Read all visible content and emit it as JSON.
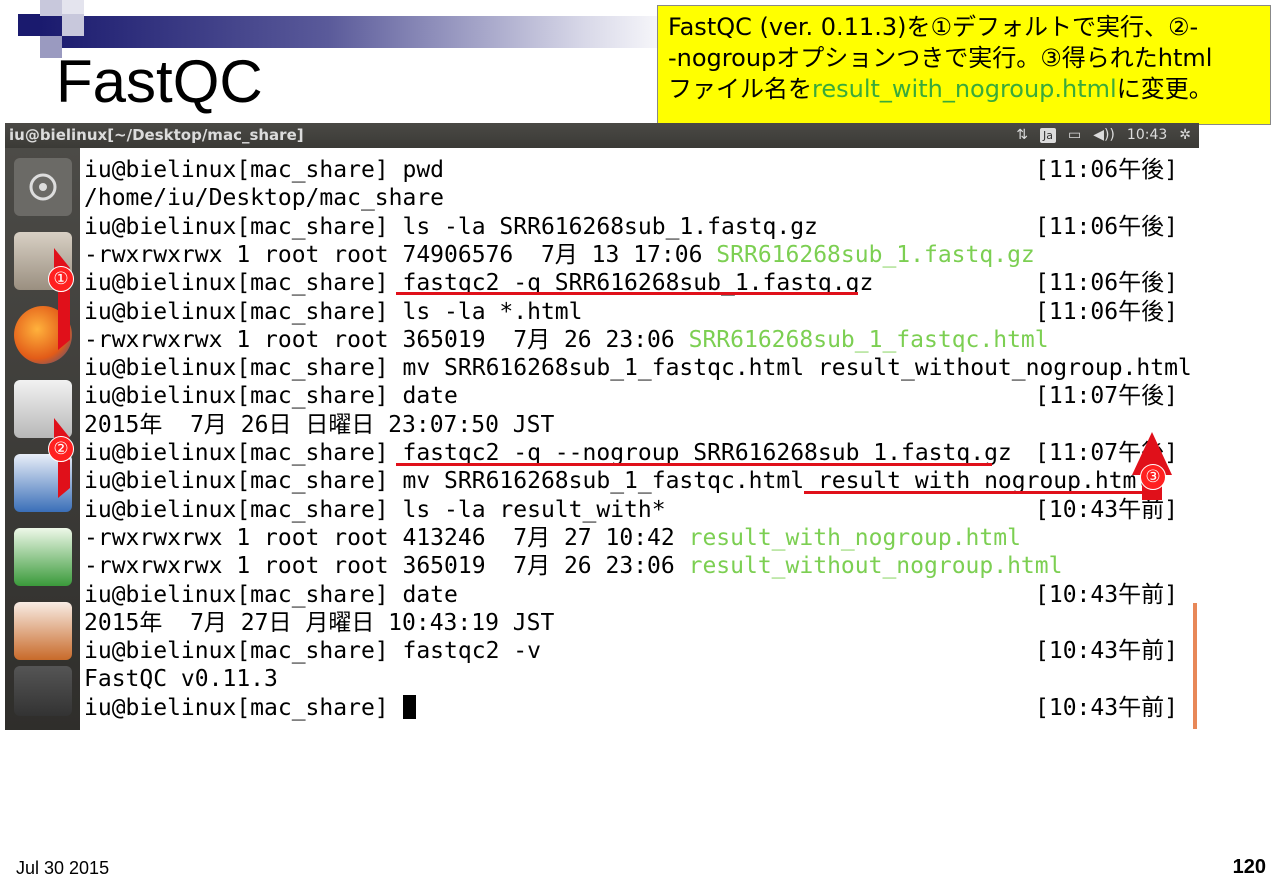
{
  "slide": {
    "title": "FastQC",
    "footer_date": "Jul 30 2015",
    "page_number": "120"
  },
  "note": {
    "part1": "FastQC (ver. 0.11.3)を①デフォルトで実行、②-",
    "part2": "-nogroupオプションつきで実行。③得られたhtml",
    "part3": "ファイル名を",
    "highlight": "result_with_nogroup.html",
    "part4": "に変更。"
  },
  "window": {
    "title": "iu@bielinux[~/Desktop/mac_share]",
    "tray": {
      "input_method": "Ja",
      "clock": "10:43"
    }
  },
  "launcher": {
    "items": [
      "dash-home",
      "files",
      "firefox",
      "mail",
      "writer",
      "calc",
      "impress"
    ]
  },
  "terminal": {
    "lines": [
      {
        "text": "iu@bielinux[mac_share] pwd",
        "ts": "[11:06午後]"
      },
      {
        "text": "/home/iu/Desktop/mac_share",
        "ts": ""
      },
      {
        "text": "iu@bielinux[mac_share] ls -la SRR616268sub_1.fastq.gz",
        "ts": "[11:06午後]"
      },
      {
        "text": "-rwxrwxrwx 1 root root 74906576  7月 13 17:06 ",
        "green": "SRR616268sub_1.fastq.gz",
        "ts": ""
      },
      {
        "text": "iu@bielinux[mac_share] fastqc2 -q SRR616268sub_1.fastq.gz",
        "ts": "[11:06午後]"
      },
      {
        "text": "iu@bielinux[mac_share] ls -la *.html",
        "ts": "[11:06午後]"
      },
      {
        "text": "-rwxrwxrwx 1 root root 365019  7月 26 23:06 ",
        "green": "SRR616268sub_1_fastqc.html",
        "ts": ""
      },
      {
        "text": "iu@bielinux[mac_share] mv SRR616268sub_1_fastqc.html result_without_nogroup.html",
        "ts": ""
      },
      {
        "text": "iu@bielinux[mac_share] date",
        "ts": "[11:07午後]"
      },
      {
        "text": "2015年  7月 26日 日曜日 23:07:50 JST",
        "ts": ""
      },
      {
        "text": "iu@bielinux[mac_share] fastqc2 -q --nogroup SRR616268sub_1.fastq.gz",
        "ts": "[11:07午後]"
      },
      {
        "text": "iu@bielinux[mac_share] mv SRR616268sub_1_fastqc.html result_with_nogroup.html",
        "ts": ""
      },
      {
        "text": "iu@bielinux[mac_share] ls -la result_with*",
        "ts": "[10:43午前]"
      },
      {
        "text": "-rwxrwxrwx 1 root root 413246  7月 27 10:42 ",
        "green": "result_with_nogroup.html",
        "ts": ""
      },
      {
        "text": "-rwxrwxrwx 1 root root 365019  7月 26 23:06 ",
        "green": "result_without_nogroup.html",
        "ts": ""
      },
      {
        "text": "iu@bielinux[mac_share] date",
        "ts": "[10:43午前]"
      },
      {
        "text": "2015年  7月 27日 月曜日 10:43:19 JST",
        "ts": ""
      },
      {
        "text": "iu@bielinux[mac_share] fastqc2 -v",
        "ts": "[10:43午前]"
      },
      {
        "text": "FastQC v0.11.3",
        "ts": ""
      },
      {
        "text": "iu@bielinux[mac_share] ",
        "ts": "[10:43午前]"
      }
    ]
  },
  "annotations": {
    "badge1": "①",
    "badge2": "②",
    "badge3": "③",
    "color": "#e0101a"
  }
}
